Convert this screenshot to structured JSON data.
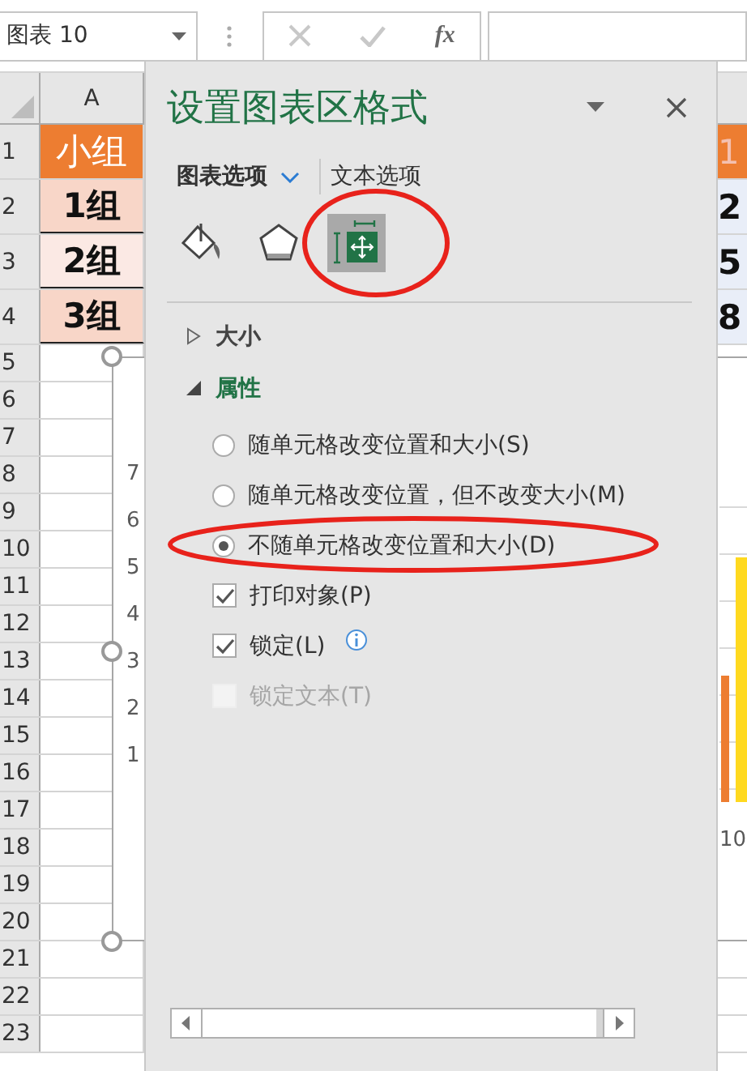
{
  "name_box": {
    "value": "图表 10"
  },
  "formula_bar": {
    "function_label": "fx"
  },
  "columns": [
    {
      "label": "A"
    }
  ],
  "rows": [
    {
      "number": "1",
      "kind": "title",
      "cell": "小组",
      "edge_value": "1"
    },
    {
      "number": "2",
      "kind": "data",
      "cell": "1组",
      "edge_value": "2"
    },
    {
      "number": "3",
      "kind": "data",
      "cell": "2组",
      "edge_value": "5"
    },
    {
      "number": "4",
      "kind": "data",
      "cell": "3组",
      "edge_value": "8"
    },
    {
      "number": "5",
      "kind": "empty"
    },
    {
      "number": "6",
      "kind": "empty"
    },
    {
      "number": "7",
      "kind": "empty"
    },
    {
      "number": "8",
      "kind": "empty"
    },
    {
      "number": "9",
      "kind": "empty"
    },
    {
      "number": "10",
      "kind": "empty"
    },
    {
      "number": "11",
      "kind": "empty"
    },
    {
      "number": "12",
      "kind": "empty"
    },
    {
      "number": "13",
      "kind": "empty"
    },
    {
      "number": "14",
      "kind": "empty"
    },
    {
      "number": "15",
      "kind": "empty"
    },
    {
      "number": "16",
      "kind": "empty"
    },
    {
      "number": "17",
      "kind": "empty"
    },
    {
      "number": "18",
      "kind": "empty"
    },
    {
      "number": "19",
      "kind": "empty"
    },
    {
      "number": "20",
      "kind": "empty"
    },
    {
      "number": "21",
      "kind": "empty"
    },
    {
      "number": "22",
      "kind": "empty"
    },
    {
      "number": "23",
      "kind": "empty"
    }
  ],
  "chart": {
    "axis_labels": [
      "7",
      "6",
      "5",
      "4",
      "3",
      "2",
      "1"
    ],
    "category_label": "10"
  },
  "panel": {
    "title": "设置图表区格式",
    "tabs": [
      {
        "label": "图表选项",
        "selected": true
      },
      {
        "label": "文本选项",
        "selected": false
      }
    ],
    "icons": [
      {
        "kind": "fill",
        "selected": false,
        "circled": false
      },
      {
        "kind": "effects",
        "selected": false,
        "circled": false
      },
      {
        "kind": "size",
        "selected": true,
        "circled": true
      }
    ],
    "sections": [
      {
        "label": "大小",
        "expanded": false
      },
      {
        "label": "属性",
        "expanded": true,
        "options": [
          {
            "kind": "radio",
            "label": "随单元格改变位置和大小(S)",
            "selected": false,
            "circled": false
          },
          {
            "kind": "radio",
            "label": "随单元格改变位置，但不改变大小(M)",
            "selected": false,
            "circled": false
          },
          {
            "kind": "radio",
            "label": "不随单元格改变位置和大小(D)",
            "selected": true,
            "circled": true
          },
          {
            "kind": "checkbox",
            "label": "打印对象(P)",
            "checked": true,
            "disabled": false,
            "info": false
          },
          {
            "kind": "checkbox",
            "label": "锁定(L)",
            "checked": true,
            "disabled": false,
            "info": true
          },
          {
            "kind": "checkbox",
            "label": "锁定文本(T)",
            "checked": false,
            "disabled": true,
            "info": false
          }
        ]
      }
    ]
  }
}
